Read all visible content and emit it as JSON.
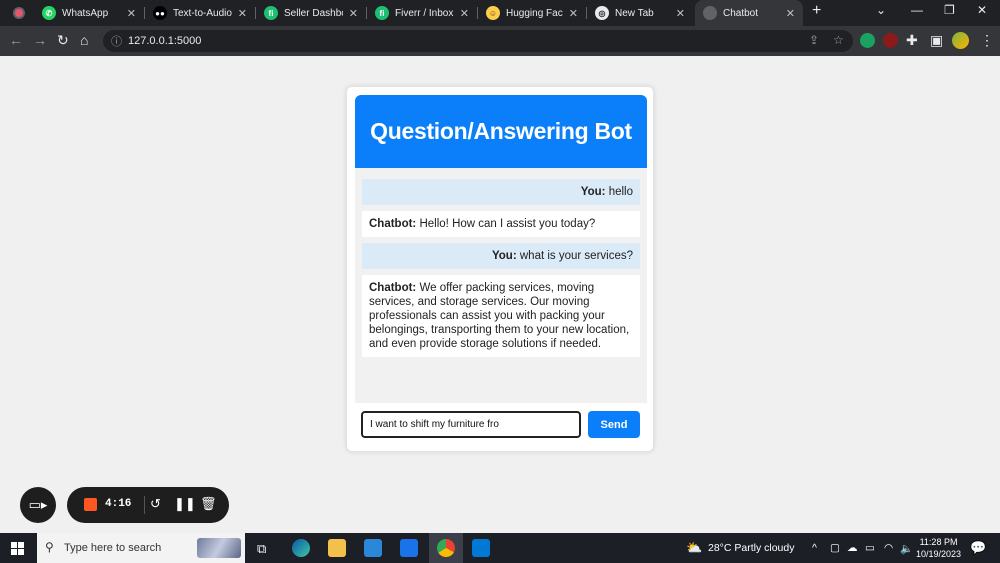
{
  "browser": {
    "tabs": [
      {
        "label": "WhatsApp",
        "icon": "whatsapp-icon"
      },
      {
        "label": "Text-to-Audio (",
        "icon": "medium-icon"
      },
      {
        "label": "Seller Dashboa",
        "icon": "fiverr-icon"
      },
      {
        "label": "Fiverr / Inbox",
        "icon": "fiverr-icon"
      },
      {
        "label": "Hugging Face",
        "icon": "hugging-face-icon"
      },
      {
        "label": "New Tab",
        "icon": "chrome-icon"
      },
      {
        "label": "Chatbot",
        "icon": "globe-icon"
      }
    ],
    "url": "127.0.0.1:5000"
  },
  "chat": {
    "title": "Question/Answering Bot",
    "messages": [
      {
        "sender": "You:",
        "text": "hello",
        "role": "user"
      },
      {
        "sender": "Chatbot:",
        "text": "Hello! How can I assist you today?",
        "role": "bot"
      },
      {
        "sender": "You:",
        "text": "what is your services?",
        "role": "user"
      },
      {
        "sender": "Chatbot:",
        "text": "We offer packing services, moving services, and storage services. Our moving professionals can assist you with packing your belongings, transporting them to your new location, and even provide storage solutions if needed.",
        "role": "bot"
      }
    ],
    "input_value": "I want to shift my furniture fro",
    "send_label": "Send",
    "accent_color": "#0a7ff9"
  },
  "recorder": {
    "time": "4:16"
  },
  "taskbar": {
    "search_placeholder": "Type here to search",
    "weather": "28°C  Partly cloudy",
    "time": "11:28 PM",
    "date": "10/19/2023"
  }
}
